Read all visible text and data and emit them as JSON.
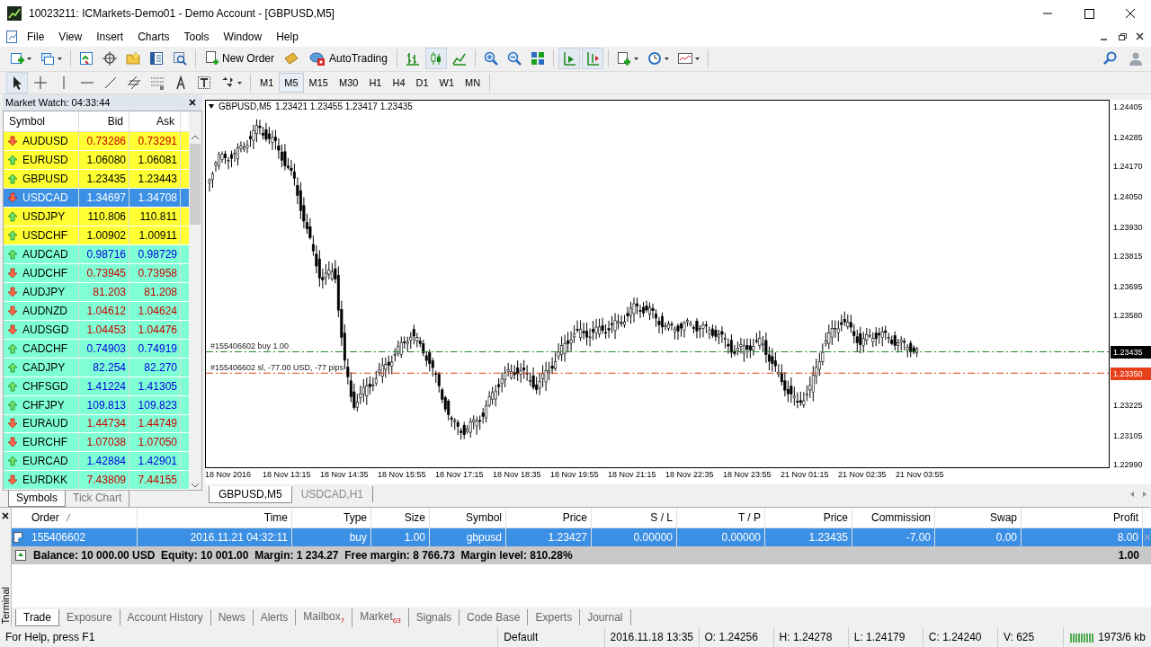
{
  "window": {
    "title": "10023211: ICMarkets-Demo01 - Demo Account - [GBPUSD,M5]"
  },
  "menu": [
    "File",
    "View",
    "Insert",
    "Charts",
    "Tools",
    "Window",
    "Help"
  ],
  "toolbar": {
    "new_order": "New Order",
    "auto_trading": "AutoTrading"
  },
  "timeframes": [
    {
      "label": "M1",
      "selected": false
    },
    {
      "label": "M5",
      "selected": true
    },
    {
      "label": "M15",
      "selected": false
    },
    {
      "label": "M30",
      "selected": false
    },
    {
      "label": "H1",
      "selected": false
    },
    {
      "label": "H4",
      "selected": false
    },
    {
      "label": "D1",
      "selected": false
    },
    {
      "label": "W1",
      "selected": false
    },
    {
      "label": "MN",
      "selected": false
    }
  ],
  "market_watch": {
    "title": "Market Watch: 04:33:44",
    "columns": [
      "Symbol",
      "Bid",
      "Ask"
    ],
    "rows": [
      {
        "symbol": "AUDUSD",
        "bid": "0.73286",
        "ask": "0.73291",
        "rising": false,
        "price_colored": true,
        "color": "#ffff33",
        "selected": false
      },
      {
        "symbol": "EURUSD",
        "bid": "1.06080",
        "ask": "1.06081",
        "rising": true,
        "price_colored": false,
        "color": "#ffff33",
        "selected": false
      },
      {
        "symbol": "GBPUSD",
        "bid": "1.23435",
        "ask": "1.23443",
        "rising": true,
        "price_colored": false,
        "color": "#ffff33",
        "selected": false
      },
      {
        "symbol": "USDCAD",
        "bid": "1.34697",
        "ask": "1.34708",
        "rising": false,
        "selected": true
      },
      {
        "symbol": "USDJPY",
        "bid": "110.806",
        "ask": "110.811",
        "rising": true,
        "price_colored": false,
        "color": "#ffff33",
        "selected": false
      },
      {
        "symbol": "USDCHF",
        "bid": "1.00902",
        "ask": "1.00911",
        "rising": true,
        "price_colored": false,
        "color": "#ffff33",
        "selected": false
      },
      {
        "symbol": "AUDCAD",
        "bid": "0.98716",
        "ask": "0.98729",
        "rising": true,
        "price_colored": true,
        "color": "#7fffd4",
        "selected": false
      },
      {
        "symbol": "AUDCHF",
        "bid": "0.73945",
        "ask": "0.73958",
        "rising": false,
        "price_colored": true,
        "color": "#7fffd4",
        "selected": false
      },
      {
        "symbol": "AUDJPY",
        "bid": "81.203",
        "ask": "81.208",
        "rising": false,
        "price_colored": true,
        "color": "#7fffd4",
        "selected": false
      },
      {
        "symbol": "AUDNZD",
        "bid": "1.04612",
        "ask": "1.04624",
        "rising": false,
        "price_colored": true,
        "color": "#7fffd4",
        "selected": false
      },
      {
        "symbol": "AUDSGD",
        "bid": "1.04453",
        "ask": "1.04476",
        "rising": false,
        "price_colored": true,
        "color": "#7fffd4",
        "selected": false
      },
      {
        "symbol": "CADCHF",
        "bid": "0.74903",
        "ask": "0.74919",
        "rising": true,
        "price_colored": true,
        "color": "#7fffd4",
        "selected": false
      },
      {
        "symbol": "CADJPY",
        "bid": "82.254",
        "ask": "82.270",
        "rising": true,
        "price_colored": true,
        "color": "#7fffd4",
        "selected": false
      },
      {
        "symbol": "CHFSGD",
        "bid": "1.41224",
        "ask": "1.41305",
        "rising": true,
        "price_colored": true,
        "color": "#7fffd4",
        "selected": false
      },
      {
        "symbol": "CHFJPY",
        "bid": "109.813",
        "ask": "109.823",
        "rising": true,
        "price_colored": true,
        "color": "#7fffd4",
        "selected": false
      },
      {
        "symbol": "EURAUD",
        "bid": "1.44734",
        "ask": "1.44749",
        "rising": false,
        "price_colored": true,
        "color": "#7fffd4",
        "selected": false
      },
      {
        "symbol": "EURCHF",
        "bid": "1.07038",
        "ask": "1.07050",
        "rising": false,
        "price_colored": true,
        "color": "#7fffd4",
        "selected": false
      },
      {
        "symbol": "EURCAD",
        "bid": "1.42884",
        "ask": "1.42901",
        "rising": true,
        "price_colored": true,
        "color": "#7fffd4",
        "selected": false
      },
      {
        "symbol": "EURDKK",
        "bid": "7.43809",
        "ask": "7.44155",
        "rising": false,
        "price_colored": true,
        "color": "#7fffd4",
        "selected": false
      }
    ],
    "tabs": [
      {
        "label": "Symbols",
        "selected": true
      },
      {
        "label": "Tick Chart",
        "selected": false
      }
    ]
  },
  "chart": {
    "symbol": "GBPUSD,M5",
    "ohlc": "1.23421 1.23455 1.23417 1.23435",
    "price_axis": [
      "1.24405",
      "1.24285",
      "1.24170",
      "1.24050",
      "1.23930",
      "1.23815",
      "1.23695",
      "1.23580",
      "1.23225",
      "1.23105",
      "1.22990"
    ],
    "price_lines": [
      {
        "kind": "buy",
        "label": "#155406602 buy 1.00",
        "axis_label": "1.23435"
      },
      {
        "kind": "stop_loss",
        "label": "#155406602 sl, -77.00 USD, -77 pips",
        "axis_label": "1.23350"
      }
    ],
    "time_axis": [
      "18 Nov 2016",
      "18 Nov 13:15",
      "18 Nov 14:35",
      "18 Nov 15:55",
      "18 Nov 17:15",
      "18 Nov 18:35",
      "18 Nov 19:55",
      "18 Nov 21:15",
      "18 Nov 22:35",
      "18 Nov 23:55",
      "21 Nov 01:15",
      "21 Nov 02:35",
      "21 Nov 03:55"
    ]
  },
  "chart_tabs": [
    {
      "label": "GBPUSD,M5",
      "selected": true
    },
    {
      "label": "USDCAD,H1",
      "selected": false
    }
  ],
  "terminal": {
    "label": "Terminal",
    "columns": [
      "Order",
      "Time",
      "Type",
      "Size",
      "Symbol",
      "Price",
      "S / L",
      "T / P",
      "Price",
      "Commission",
      "Swap",
      "Profit"
    ],
    "orders": [
      {
        "selected": true,
        "cells": [
          "155406602",
          "2016.11.21 04:32:11",
          "buy",
          "1.00",
          "gbpusd",
          "1.23427",
          "0.00000",
          "0.00000",
          "1.23435",
          "-7.00",
          "0.00",
          "8.00"
        ]
      }
    ],
    "balance": "Balance: 10 000.00 USD  Equity: 10 001.00  Margin: 1 234.27  Free margin: 8 766.73  Margin level: 810.28%",
    "total": "1.00",
    "tabs": [
      {
        "label": "Trade",
        "selected": true
      },
      {
        "label": "Exposure",
        "selected": false
      },
      {
        "label": "Account History",
        "selected": false
      },
      {
        "label": "News",
        "selected": false
      },
      {
        "label": "Alerts",
        "selected": false
      },
      {
        "label": "Mailbox",
        "badge": "7",
        "selected": false
      },
      {
        "label": "Market",
        "badge": "63",
        "selected": false
      },
      {
        "label": "Signals",
        "selected": false
      },
      {
        "label": "Code Base",
        "selected": false
      },
      {
        "label": "Experts",
        "selected": false
      },
      {
        "label": "Journal",
        "selected": false
      }
    ]
  },
  "status_bar": {
    "help": "For Help, press F1",
    "profile": "Default",
    "time": "2016.11.18 13:35",
    "open": "O: 1.24256",
    "high": "H: 1.24278",
    "low": "L: 1.24179",
    "close": "C: 1.24240",
    "volume": "V: 625",
    "traffic": "1973/6 kb"
  }
}
